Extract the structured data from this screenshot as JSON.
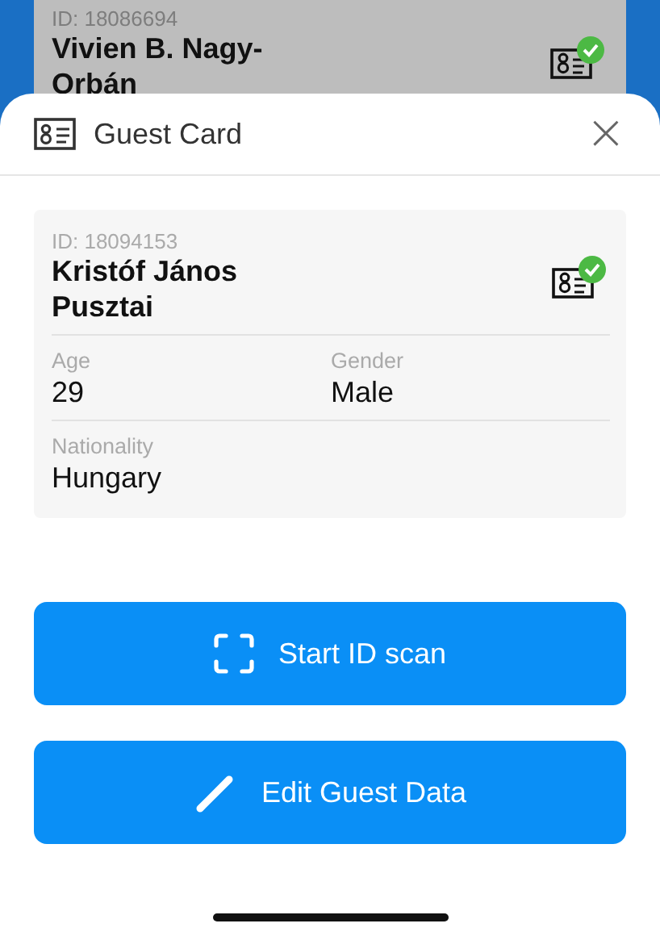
{
  "background_card": {
    "id": "ID: 18086694",
    "name": "Vivien B. Nagy-Orbán",
    "verified": true
  },
  "sheet": {
    "title": "Guest Card",
    "close": "×"
  },
  "guest": {
    "id": "ID: 18094153",
    "name": "Kristóf János Pusztai",
    "verified": true,
    "fields": [
      {
        "label": "Age",
        "value": "29"
      },
      {
        "label": "Gender",
        "value": "Male"
      },
      {
        "label": "Nationality",
        "value": "Hungary"
      }
    ]
  },
  "buttons": [
    {
      "kind": "scan",
      "label": "Start ID scan"
    },
    {
      "kind": "edit",
      "label": "Edit Guest Data"
    }
  ]
}
